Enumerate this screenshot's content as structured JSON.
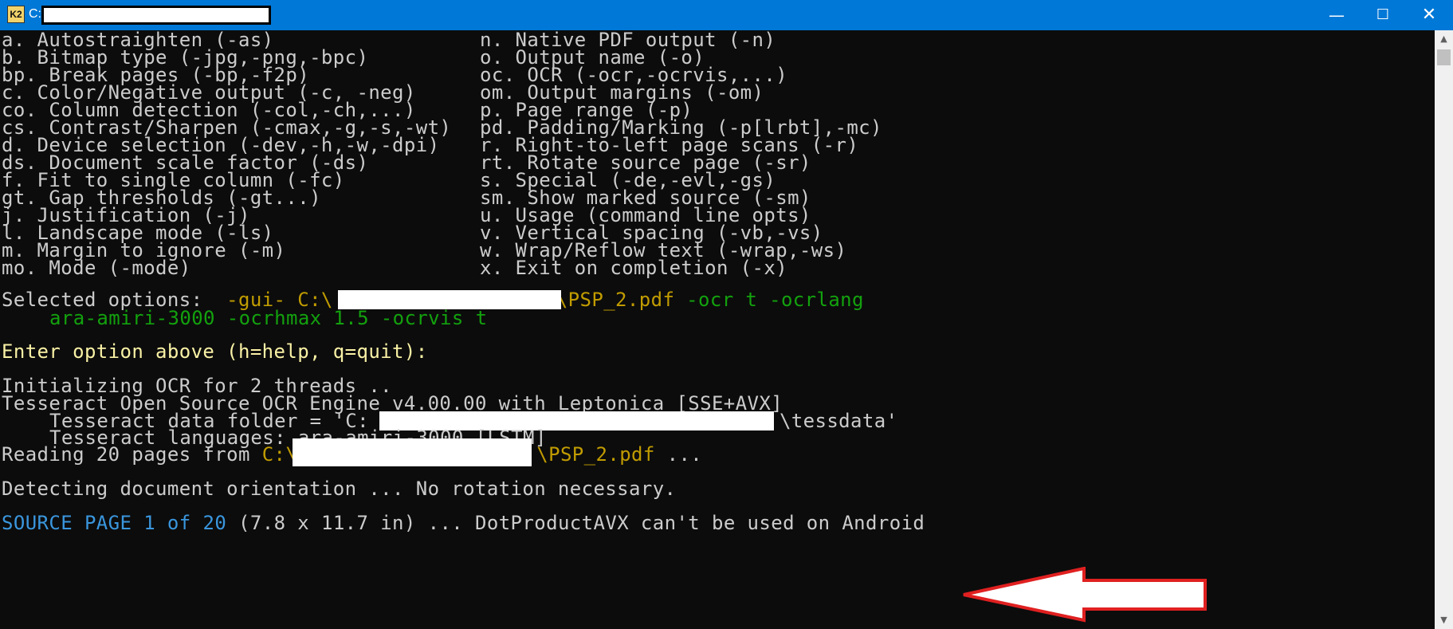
{
  "window": {
    "title_prefix": "C:",
    "icon_label": "K2",
    "minimize_glyph": "—",
    "maximize_glyph": "☐",
    "close_glyph": "✕"
  },
  "menu": {
    "left": [
      "a. Autostraighten (-as)",
      "b. Bitmap type (-jpg,-png,-bpc)",
      "bp. Break pages (-bp,-f2p)",
      "c. Color/Negative output (-c, -neg)",
      "co. Column detection (-col,-ch,...)",
      "cs. Contrast/Sharpen (-cmax,-g,-s,-wt)",
      "d. Device selection (-dev,-h,-w,-dpi)",
      "ds. Document scale factor (-ds)",
      "f. Fit to single column (-fc)",
      "gt. Gap thresholds (-gt...)",
      "j. Justification (-j)",
      "l. Landscape mode (-ls)",
      "m. Margin to ignore (-m)",
      "mo. Mode (-mode)"
    ],
    "right": [
      "n. Native PDF output (-n)",
      "o. Output name (-o)",
      "oc. OCR (-ocr,-ocrvis,...)",
      "om. Output margins (-om)",
      "p. Page range (-p)",
      "pd. Padding/Marking (-p[lrbt],-mc)",
      "r. Right-to-left page scans (-r)",
      "rt. Rotate source page (-sr)",
      "s. Special (-de,-evl,-gs)",
      "sm. Show marked source (-sm)",
      "u. Usage (command line opts)",
      "v. Vertical spacing (-vb,-vs)",
      "w. Wrap/Reflow text (-wrap,-ws)",
      "x. Exit on completion (-x)"
    ]
  },
  "selected": {
    "label": "Selected options:  ",
    "gui": "-gui- C:\\",
    "file": "\\PSP_2.pdf",
    "opts1": " -ocr t -ocrlang",
    "opts2": "ara-amiri-3000 -ocrhmax 1.5 -ocrvis t"
  },
  "prompt": "Enter option above (h=help, q=quit):",
  "log": {
    "init": "Initializing OCR for 2 threads ..",
    "engine": "Tesseract Open Source OCR Engine v4.00.00 with Leptonica [SSE+AVX]",
    "data_folder_prefix": "Tesseract data folder = 'C:",
    "data_folder_suffix": "\\tessdata'",
    "languages": "Tesseract languages: ara-amiri-3000 [LSTM]",
    "reading_prefix": "Reading 20 pages from ",
    "reading_path": "C:\\",
    "reading_file": "\\PSP_2.pdf",
    "reading_suffix": " ...",
    "detecting": "Detecting document orientation ... No rotation necessary.",
    "source_label": "SOURCE PAGE ",
    "source_num": "1",
    "source_of": " of ",
    "source_total": "20",
    "source_rest": " (7.8 x 11.7 in) ... DotProductAVX can't be used on Android"
  },
  "scrollbar": {
    "up_glyph": "▲",
    "down_glyph": "▼"
  },
  "annotation": {
    "arrow_color": "#e02020"
  }
}
